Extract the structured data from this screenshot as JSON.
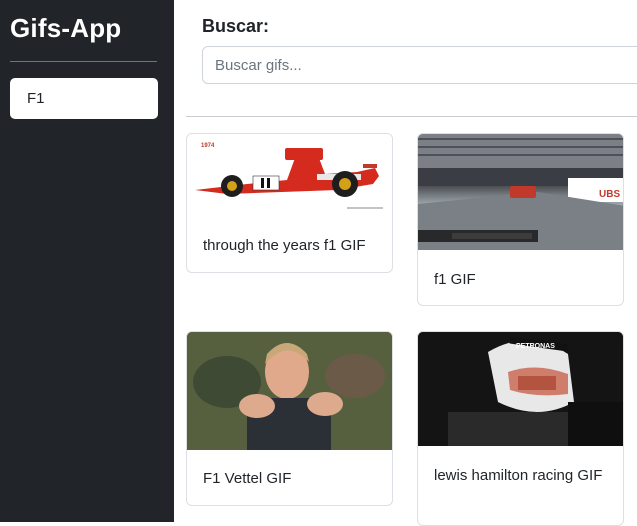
{
  "sidebar": {
    "title": "Gifs-App",
    "history": [
      "F1"
    ]
  },
  "search": {
    "label": "Buscar:",
    "placeholder": "Buscar gifs...",
    "value": ""
  },
  "gifs": [
    {
      "title": "through the years f1 GIF",
      "image": "ferrari-f1-car-drawing",
      "image_text": [
        "1974"
      ]
    },
    {
      "title": "f1 GIF",
      "image": "monaco-street-race",
      "image_text": [
        "UBS"
      ]
    },
    {
      "title": "F1 Vettel GIF",
      "image": "driver-celebrating"
    },
    {
      "title": "lewis hamilton racing GIF",
      "image": "driver-in-cockpit",
      "image_text": [
        "PETRONAS"
      ]
    }
  ]
}
